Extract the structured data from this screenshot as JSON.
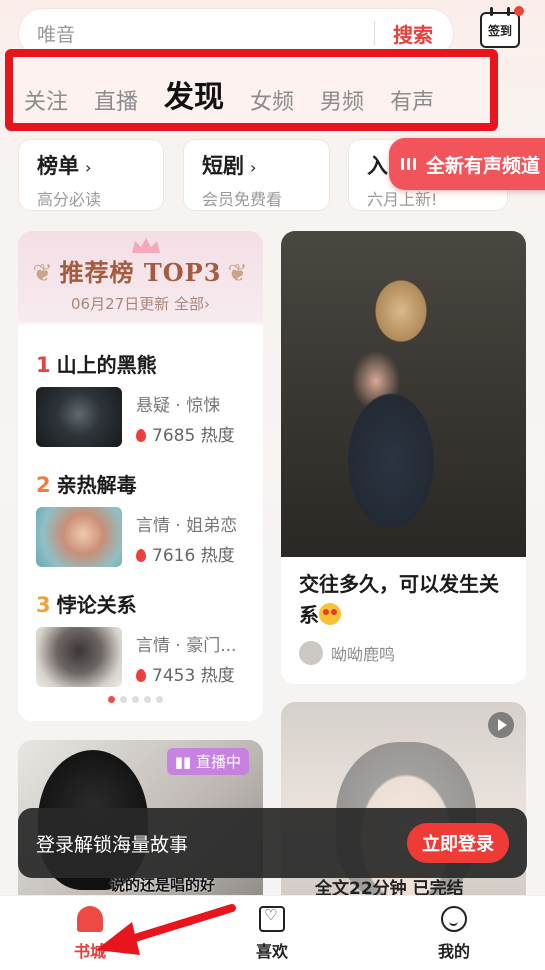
{
  "search": {
    "placeholder": "唯音",
    "button_label": "搜索"
  },
  "checkin": {
    "label": "签到"
  },
  "tabs": [
    {
      "label": "关注"
    },
    {
      "label": "直播"
    },
    {
      "label": "发现",
      "active": true
    },
    {
      "label": "女频"
    },
    {
      "label": "男频"
    },
    {
      "label": "有声"
    }
  ],
  "quick_links": [
    {
      "title": "榜单",
      "subtitle": "高分必读"
    },
    {
      "title": "短剧",
      "subtitle": "会员免费看"
    },
    {
      "title": "入",
      "subtitle": "六月上新!"
    }
  ],
  "audio_badge": {
    "label": "全新有声频道"
  },
  "top3": {
    "title": "推荐榜 TOP3",
    "subtitle": "06月27日更新 全部›",
    "items": [
      {
        "rank": "1",
        "name": "山上的黑熊",
        "genre": "悬疑 · 惊悚",
        "heat": "7685 热度"
      },
      {
        "rank": "2",
        "name": "亲热解毒",
        "genre": "言情 · 姐弟恋",
        "heat": "7616 热度"
      },
      {
        "rank": "3",
        "name": "悖论关系",
        "genre": "言情 · 豪门...",
        "heat": "7453 热度"
      }
    ]
  },
  "feed_card": {
    "title": "交往多久，可以发生关系",
    "author": "呦呦鹿鸣"
  },
  "live_card": {
    "tag": "直播中",
    "caption": "说的还是唱的好"
  },
  "anime_card": {
    "caption": "全文22分钟 已完结"
  },
  "login_toast": {
    "message": "登录解锁海量故事",
    "button_label": "立即登录"
  },
  "bottom_nav": [
    {
      "label": "书城",
      "active": true
    },
    {
      "label": "喜欢"
    },
    {
      "label": "我的"
    }
  ],
  "colors": {
    "accent": "#ee3b36",
    "annotation": "#e8161c"
  }
}
